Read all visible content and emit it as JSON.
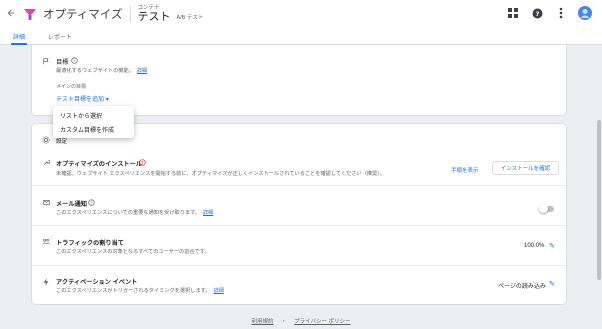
{
  "header": {
    "back_icon": "arrow-back-icon",
    "app_title": "オプティマイズ",
    "container_label": "コンテナ",
    "container_name": "テスト",
    "badge": "A/B テスト",
    "icons": [
      "apps-icon",
      "help-icon",
      "more-vert-icon",
      "avatar"
    ],
    "brand_colors": [
      "#e8479a",
      "#a142f4"
    ]
  },
  "tabs": [
    {
      "label": "詳細",
      "active": true
    },
    {
      "label": "レポート",
      "active": false
    }
  ],
  "goal_card": {
    "title": "目標",
    "description": "最適化するウェブサイトの機能。",
    "desc_link": "詳細",
    "main_goal_label": "メインの目標",
    "add_goal_label": "テスト目標を追加"
  },
  "dropdown_menu": {
    "items": [
      "リストから選択",
      "カスタム目標を作成"
    ]
  },
  "settings_card": {
    "title": "設定",
    "install": {
      "title": "オプティマイズのインストール",
      "description": "未確認。ウェブサイト エクスペリエンスを開始する前に、オプティマイズが正しくインストールされていることを確認してください（推奨）。",
      "show_steps": "手順を表示",
      "check_button": "インストールを確認"
    },
    "email": {
      "title": "メール通知",
      "description": "このエクスペリエンスについての重要な通知を受け取ります。",
      "link": "詳細",
      "enabled": false
    },
    "traffic": {
      "title": "トラフィックの割り当て",
      "description": "このエクスペリエンスの対象となるすべてのユーザーの割合です。",
      "value": "100.0%"
    },
    "activation": {
      "title": "アクティベーション イベント",
      "description": "このエクスペリエンスがトリガーされるタイミングを選択します。",
      "link": "詳細",
      "value": "ページの読み込み"
    }
  },
  "footer": {
    "terms": "利用規約",
    "separator": "・",
    "privacy": "プライバシー ポリシー"
  },
  "colors": {
    "accent": "#1a73e8",
    "warning": "#d93025",
    "background": "#eceff1"
  }
}
